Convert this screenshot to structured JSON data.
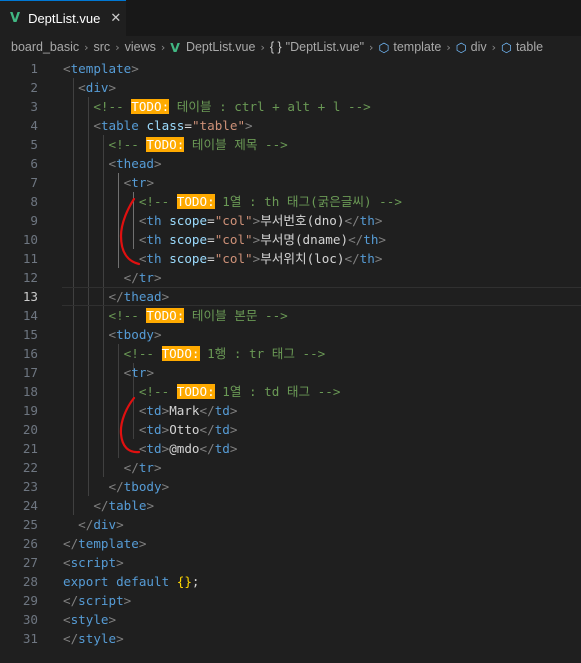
{
  "tab": {
    "icon": "V",
    "filename": "DeptList.vue",
    "close": "✕"
  },
  "breadcrumb": {
    "folder1": "board_basic",
    "folder2": "src",
    "folder3": "views",
    "file": "DeptList.vue",
    "symbol1": "\"DeptList.vue\"",
    "symbol2": "template",
    "symbol3": "div",
    "symbol4": "table"
  },
  "editor": {
    "current_line": 13,
    "line_numbers": [
      "1",
      "2",
      "3",
      "4",
      "5",
      "6",
      "7",
      "8",
      "9",
      "10",
      "11",
      "12",
      "13",
      "14",
      "15",
      "16",
      "17",
      "18",
      "19",
      "20",
      "21",
      "22",
      "23",
      "24",
      "25",
      "26",
      "27",
      "28",
      "29",
      "30",
      "31"
    ],
    "lines": [
      [
        {
          "t": "<",
          "c": "br"
        },
        {
          "t": "template",
          "c": "tg"
        },
        {
          "t": ">",
          "c": "br"
        }
      ],
      [
        {
          "t": "  "
        },
        {
          "t": "<",
          "c": "br"
        },
        {
          "t": "div",
          "c": "tg"
        },
        {
          "t": ">",
          "c": "br"
        }
      ],
      [
        {
          "t": "    "
        },
        {
          "t": "<!-- ",
          "c": "cm"
        },
        {
          "t": "TODO:",
          "c": "todo"
        },
        {
          "t": " 테이블 : ctrl + alt + l -->",
          "c": "cm"
        }
      ],
      [
        {
          "t": "    "
        },
        {
          "t": "<",
          "c": "br"
        },
        {
          "t": "table",
          "c": "tg"
        },
        {
          "t": " "
        },
        {
          "t": "class",
          "c": "at"
        },
        {
          "t": "=",
          "c": "tx"
        },
        {
          "t": "\"table\"",
          "c": "st"
        },
        {
          "t": ">",
          "c": "br"
        }
      ],
      [
        {
          "t": "      "
        },
        {
          "t": "<!-- ",
          "c": "cm"
        },
        {
          "t": "TODO:",
          "c": "todo"
        },
        {
          "t": " 테이블 제목 -->",
          "c": "cm"
        }
      ],
      [
        {
          "t": "      "
        },
        {
          "t": "<",
          "c": "br"
        },
        {
          "t": "thead",
          "c": "tg"
        },
        {
          "t": ">",
          "c": "br"
        }
      ],
      [
        {
          "t": "        "
        },
        {
          "t": "<",
          "c": "br"
        },
        {
          "t": "tr",
          "c": "tg"
        },
        {
          "t": ">",
          "c": "br"
        }
      ],
      [
        {
          "t": "          "
        },
        {
          "t": "<!-- ",
          "c": "cm"
        },
        {
          "t": "TODO:",
          "c": "todo"
        },
        {
          "t": " 1열 : th 태그(굵은글씨) -->",
          "c": "cm"
        }
      ],
      [
        {
          "t": "          "
        },
        {
          "t": "<",
          "c": "br"
        },
        {
          "t": "th",
          "c": "tg"
        },
        {
          "t": " "
        },
        {
          "t": "scope",
          "c": "at"
        },
        {
          "t": "=",
          "c": "tx"
        },
        {
          "t": "\"col\"",
          "c": "st"
        },
        {
          "t": ">",
          "c": "br"
        },
        {
          "t": "부서번호(dno)",
          "c": "tx"
        },
        {
          "t": "</",
          "c": "br"
        },
        {
          "t": "th",
          "c": "tg"
        },
        {
          "t": ">",
          "c": "br"
        }
      ],
      [
        {
          "t": "          "
        },
        {
          "t": "<",
          "c": "br"
        },
        {
          "t": "th",
          "c": "tg"
        },
        {
          "t": " "
        },
        {
          "t": "scope",
          "c": "at"
        },
        {
          "t": "=",
          "c": "tx"
        },
        {
          "t": "\"col\"",
          "c": "st"
        },
        {
          "t": ">",
          "c": "br"
        },
        {
          "t": "부서명(dname)",
          "c": "tx"
        },
        {
          "t": "</",
          "c": "br"
        },
        {
          "t": "th",
          "c": "tg"
        },
        {
          "t": ">",
          "c": "br"
        }
      ],
      [
        {
          "t": "          "
        },
        {
          "t": "<",
          "c": "br"
        },
        {
          "t": "th",
          "c": "tg"
        },
        {
          "t": " "
        },
        {
          "t": "scope",
          "c": "at"
        },
        {
          "t": "=",
          "c": "tx"
        },
        {
          "t": "\"col\"",
          "c": "st"
        },
        {
          "t": ">",
          "c": "br"
        },
        {
          "t": "부서위치(loc)",
          "c": "tx"
        },
        {
          "t": "</",
          "c": "br"
        },
        {
          "t": "th",
          "c": "tg"
        },
        {
          "t": ">",
          "c": "br"
        }
      ],
      [
        {
          "t": "        "
        },
        {
          "t": "</",
          "c": "br"
        },
        {
          "t": "tr",
          "c": "tg"
        },
        {
          "t": ">",
          "c": "br"
        }
      ],
      [
        {
          "t": "      "
        },
        {
          "t": "</",
          "c": "br"
        },
        {
          "t": "thead",
          "c": "tg"
        },
        {
          "t": ">",
          "c": "br"
        }
      ],
      [
        {
          "t": "      "
        },
        {
          "t": "<!-- ",
          "c": "cm"
        },
        {
          "t": "TODO:",
          "c": "todo"
        },
        {
          "t": " 테이블 본문 -->",
          "c": "cm"
        }
      ],
      [
        {
          "t": "      "
        },
        {
          "t": "<",
          "c": "br"
        },
        {
          "t": "tbody",
          "c": "tg"
        },
        {
          "t": ">",
          "c": "br"
        }
      ],
      [
        {
          "t": "        "
        },
        {
          "t": "<!-- ",
          "c": "cm"
        },
        {
          "t": "TODO:",
          "c": "todo"
        },
        {
          "t": " 1행 : tr 태그 -->",
          "c": "cm"
        }
      ],
      [
        {
          "t": "        "
        },
        {
          "t": "<",
          "c": "br"
        },
        {
          "t": "tr",
          "c": "tg"
        },
        {
          "t": ">",
          "c": "br"
        }
      ],
      [
        {
          "t": "          "
        },
        {
          "t": "<!-- ",
          "c": "cm"
        },
        {
          "t": "TODO:",
          "c": "todo"
        },
        {
          "t": " 1열 : td 태그 -->",
          "c": "cm"
        }
      ],
      [
        {
          "t": "          "
        },
        {
          "t": "<",
          "c": "br"
        },
        {
          "t": "td",
          "c": "tg"
        },
        {
          "t": ">",
          "c": "br"
        },
        {
          "t": "Mark",
          "c": "tx"
        },
        {
          "t": "</",
          "c": "br"
        },
        {
          "t": "td",
          "c": "tg"
        },
        {
          "t": ">",
          "c": "br"
        }
      ],
      [
        {
          "t": "          "
        },
        {
          "t": "<",
          "c": "br"
        },
        {
          "t": "td",
          "c": "tg"
        },
        {
          "t": ">",
          "c": "br"
        },
        {
          "t": "Otto",
          "c": "tx"
        },
        {
          "t": "</",
          "c": "br"
        },
        {
          "t": "td",
          "c": "tg"
        },
        {
          "t": ">",
          "c": "br"
        }
      ],
      [
        {
          "t": "          "
        },
        {
          "t": "<",
          "c": "br"
        },
        {
          "t": "td",
          "c": "tg"
        },
        {
          "t": ">",
          "c": "br"
        },
        {
          "t": "@mdo",
          "c": "tx"
        },
        {
          "t": "</",
          "c": "br"
        },
        {
          "t": "td",
          "c": "tg"
        },
        {
          "t": ">",
          "c": "br"
        }
      ],
      [
        {
          "t": "        "
        },
        {
          "t": "</",
          "c": "br"
        },
        {
          "t": "tr",
          "c": "tg"
        },
        {
          "t": ">",
          "c": "br"
        }
      ],
      [
        {
          "t": "      "
        },
        {
          "t": "</",
          "c": "br"
        },
        {
          "t": "tbody",
          "c": "tg"
        },
        {
          "t": ">",
          "c": "br"
        }
      ],
      [
        {
          "t": "    "
        },
        {
          "t": "</",
          "c": "br"
        },
        {
          "t": "table",
          "c": "tg"
        },
        {
          "t": ">",
          "c": "br"
        }
      ],
      [
        {
          "t": "  "
        },
        {
          "t": "</",
          "c": "br"
        },
        {
          "t": "div",
          "c": "tg"
        },
        {
          "t": ">",
          "c": "br"
        }
      ],
      [
        {
          "t": "</",
          "c": "br"
        },
        {
          "t": "template",
          "c": "tg"
        },
        {
          "t": ">",
          "c": "br"
        }
      ],
      [
        {
          "t": "<",
          "c": "br"
        },
        {
          "t": "script",
          "c": "tg"
        },
        {
          "t": ">",
          "c": "br"
        }
      ],
      [
        {
          "t": "export default ",
          "c": "kw"
        },
        {
          "t": "{}",
          "c": "yb"
        },
        {
          "t": ";",
          "c": "tx"
        }
      ],
      [
        {
          "t": "</",
          "c": "br"
        },
        {
          "t": "script",
          "c": "tg"
        },
        {
          "t": ">",
          "c": "br"
        }
      ],
      [
        {
          "t": "<",
          "c": "br"
        },
        {
          "t": "style",
          "c": "tg"
        },
        {
          "t": ">",
          "c": "br"
        }
      ],
      [
        {
          "t": "</",
          "c": "br"
        },
        {
          "t": "style",
          "c": "tg"
        },
        {
          "t": ">",
          "c": "br"
        }
      ]
    ]
  },
  "colors": {
    "todo_highlight": "#ffaa00",
    "pen_annotation": "#e01010",
    "vue_icon": "#41b883"
  }
}
